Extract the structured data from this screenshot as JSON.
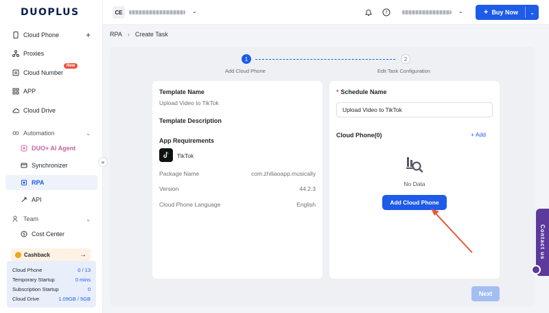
{
  "brand": {
    "logo": "DUOPLUS"
  },
  "sidebar": {
    "items": [
      {
        "label": "Cloud Phone",
        "icon": "phone-icon"
      },
      {
        "label": "Proxies",
        "icon": "proxy-icon"
      },
      {
        "label": "Cloud Number",
        "icon": "number-icon",
        "badge": "New"
      },
      {
        "label": "APP",
        "icon": "app-grid-icon"
      },
      {
        "label": "Cloud Drive",
        "icon": "cloud-icon"
      }
    ],
    "automation": {
      "label": "Automation",
      "items": [
        {
          "label": "DUO+ AI Agent"
        },
        {
          "label": "Synchronizer"
        },
        {
          "label": "RPA"
        },
        {
          "label": "API"
        }
      ]
    },
    "team": {
      "label": "Team",
      "items": [
        {
          "label": "Cost Center"
        }
      ]
    },
    "cashback": "Cashback",
    "usage": [
      {
        "label": "Cloud Phone",
        "value": "0 / 13"
      },
      {
        "label": "Temporary Startup",
        "value": "0 mins"
      },
      {
        "label": "Subscription Startup",
        "value": "0"
      },
      {
        "label": "Cloud Drive",
        "value": "1.09GB / 5GB"
      }
    ],
    "collapse": "«"
  },
  "header": {
    "workspace_initials": "CE",
    "buy_now": "Buy Now"
  },
  "breadcrumb": {
    "root": "RPA",
    "current": "Create Task"
  },
  "steps": [
    {
      "number": "1",
      "label": "Add Cloud Phone"
    },
    {
      "number": "2",
      "label": "Edit Task Configuration"
    }
  ],
  "template": {
    "name_label": "Template Name",
    "name_value": "Upload Video to TikTok",
    "description_label": "Template Description",
    "requirements_label": "App Requirements",
    "app_name": "TikTok",
    "fields": [
      {
        "label": "Package Name",
        "value": "com.zhiliaoapp.musically"
      },
      {
        "label": "Version",
        "value": "44.2.3"
      },
      {
        "label": "Cloud Phone Language",
        "value": "English"
      }
    ]
  },
  "schedule": {
    "name_label": "Schedule Name",
    "name_value": "Upload Video to TikTok",
    "cloud_phone_label": "Cloud Phone(0)",
    "add_label": "+ Add",
    "empty_text": "No Data",
    "add_cloud_phone": "Add Cloud Phone"
  },
  "footer": {
    "next": "Next"
  },
  "contact": {
    "label": "Contact us"
  },
  "colors": {
    "primary": "#1d5be8",
    "annotation_arrow": "#e8573e",
    "contact": "#5b3a9b"
  }
}
